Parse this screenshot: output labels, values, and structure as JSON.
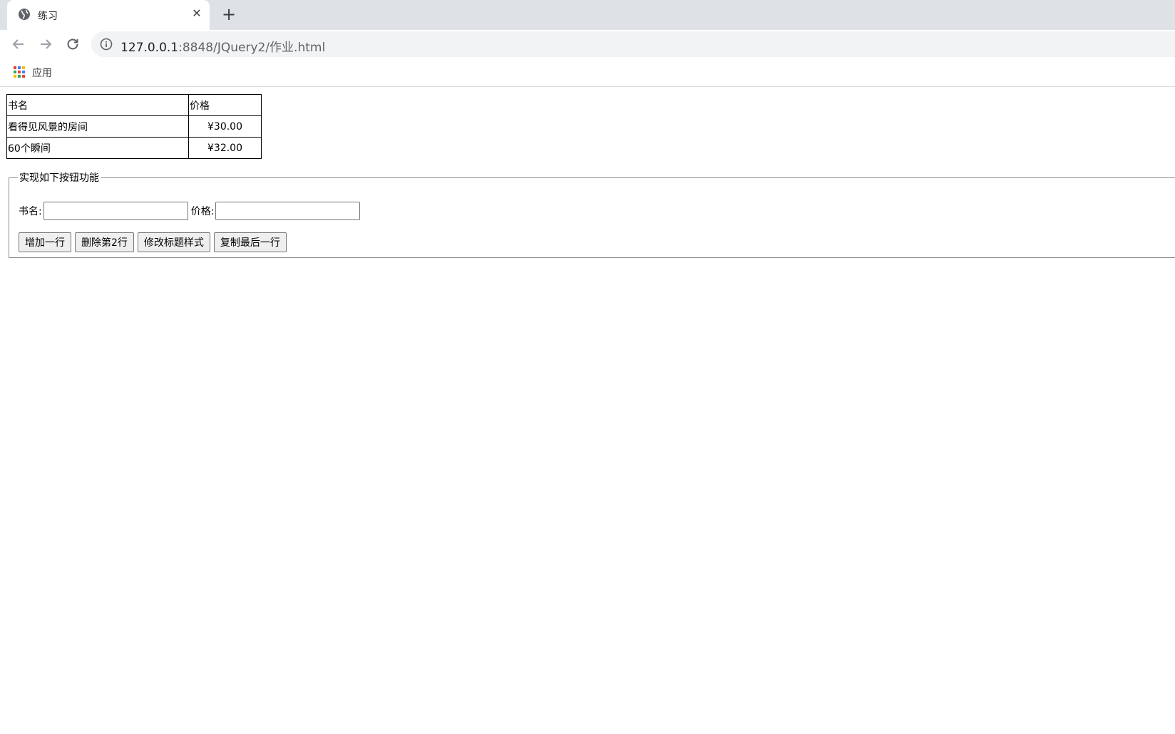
{
  "browser": {
    "tab": {
      "title": "练习",
      "close_glyph": "✕",
      "favicon": "globe-icon"
    },
    "new_tab_glyph": "+",
    "address": {
      "host": "127.0.0.1",
      "path": ":8848/JQuery2/作业.html"
    },
    "bookmarks": {
      "apps_label": "应用"
    },
    "colors": {
      "tabstrip": "#dee1e6",
      "omnibox": "#f1f3f4"
    }
  },
  "page": {
    "table": {
      "headers": [
        "书名",
        "价格"
      ],
      "rows": [
        {
          "name": "看得见风景的房间",
          "price": "¥30.00"
        },
        {
          "name": "60个瞬间",
          "price": "¥32.00"
        }
      ]
    },
    "fieldset": {
      "legend": "实现如下按钮功能",
      "name_label": "书名:",
      "price_label": "价格:",
      "name_value": "",
      "price_value": "",
      "buttons": {
        "add_row": "增加一行",
        "delete_second": "删除第2行",
        "modify_title": "修改标题样式",
        "copy_last": "复制最后一行"
      }
    }
  }
}
